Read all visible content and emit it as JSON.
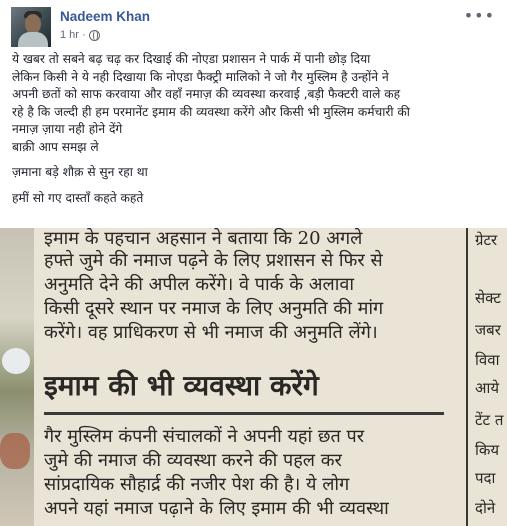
{
  "post": {
    "author": "Nadeem Khan",
    "timestamp": "1 hr",
    "lines": [
      "ये खबर तो सबने बढ़ चढ़ कर दिखाई की नोएडा प्रशासन ने पार्क में पानी छोड़ दिया",
      "लेकिन किसी ने ये नही दिखाया कि नोएडा फैक्ट्री मालिको ने जो गैर मुस्लिम है उन्होंने ने",
      "अपनी छतों को साफ करवाया और वहाँ नमाज़ की व्यवस्था करवाई ,बड़ी फैक्टरी वाले कह",
      "रहे है कि जल्दी ही हम परमानेंट इमाम की व्यवस्था करेंगे और किसी भी मुस्लिम कर्मचारी की",
      "नमाज़ ज़ाया नही होने देंगे",
      "बाक़ी आप समझ ले"
    ],
    "line2": "ज़माना बड़े शौक़ से सुन रहा था",
    "line3": "हमीं सो गए दास्ताँ कहते कहते"
  },
  "photo": {
    "text_lines": [
      "इमाम के पहचान अहसान ने बताया कि 20 अगले",
      "हफ्ते जुमे की नमाज पढ़ने के लिए प्रशासन से फिर से",
      "अनुमति देने की अपील करेंगे। वे पार्क के अलावा",
      "किसी दूसरे स्थान पर नमाज के लिए अनुमति की मांग",
      "करेंगे। वह प्राधिकरण से भी नमाज की अनुमति लेंगे।"
    ],
    "headline": "इमाम की भी व्यवस्था करेंगे",
    "body_lines": [
      "गैर मुस्लिम कंपनी संचालकों ने अपनी यहां छत पर",
      "जुमे की नमाज की व्यवस्था करने की पहल कर",
      "सांप्रदायिक सौहार्द्र की नजीर पेश की है। ये लोग",
      "अपने यहां नमाज पढ़ाने के लिए इमाम की भी व्यवस्था"
    ],
    "right_col": [
      "ग्रेटर",
      "सेक्ट",
      "जबर",
      "विवा",
      "आये",
      "टेंट त",
      "किय",
      "पदा",
      "दोने"
    ]
  }
}
